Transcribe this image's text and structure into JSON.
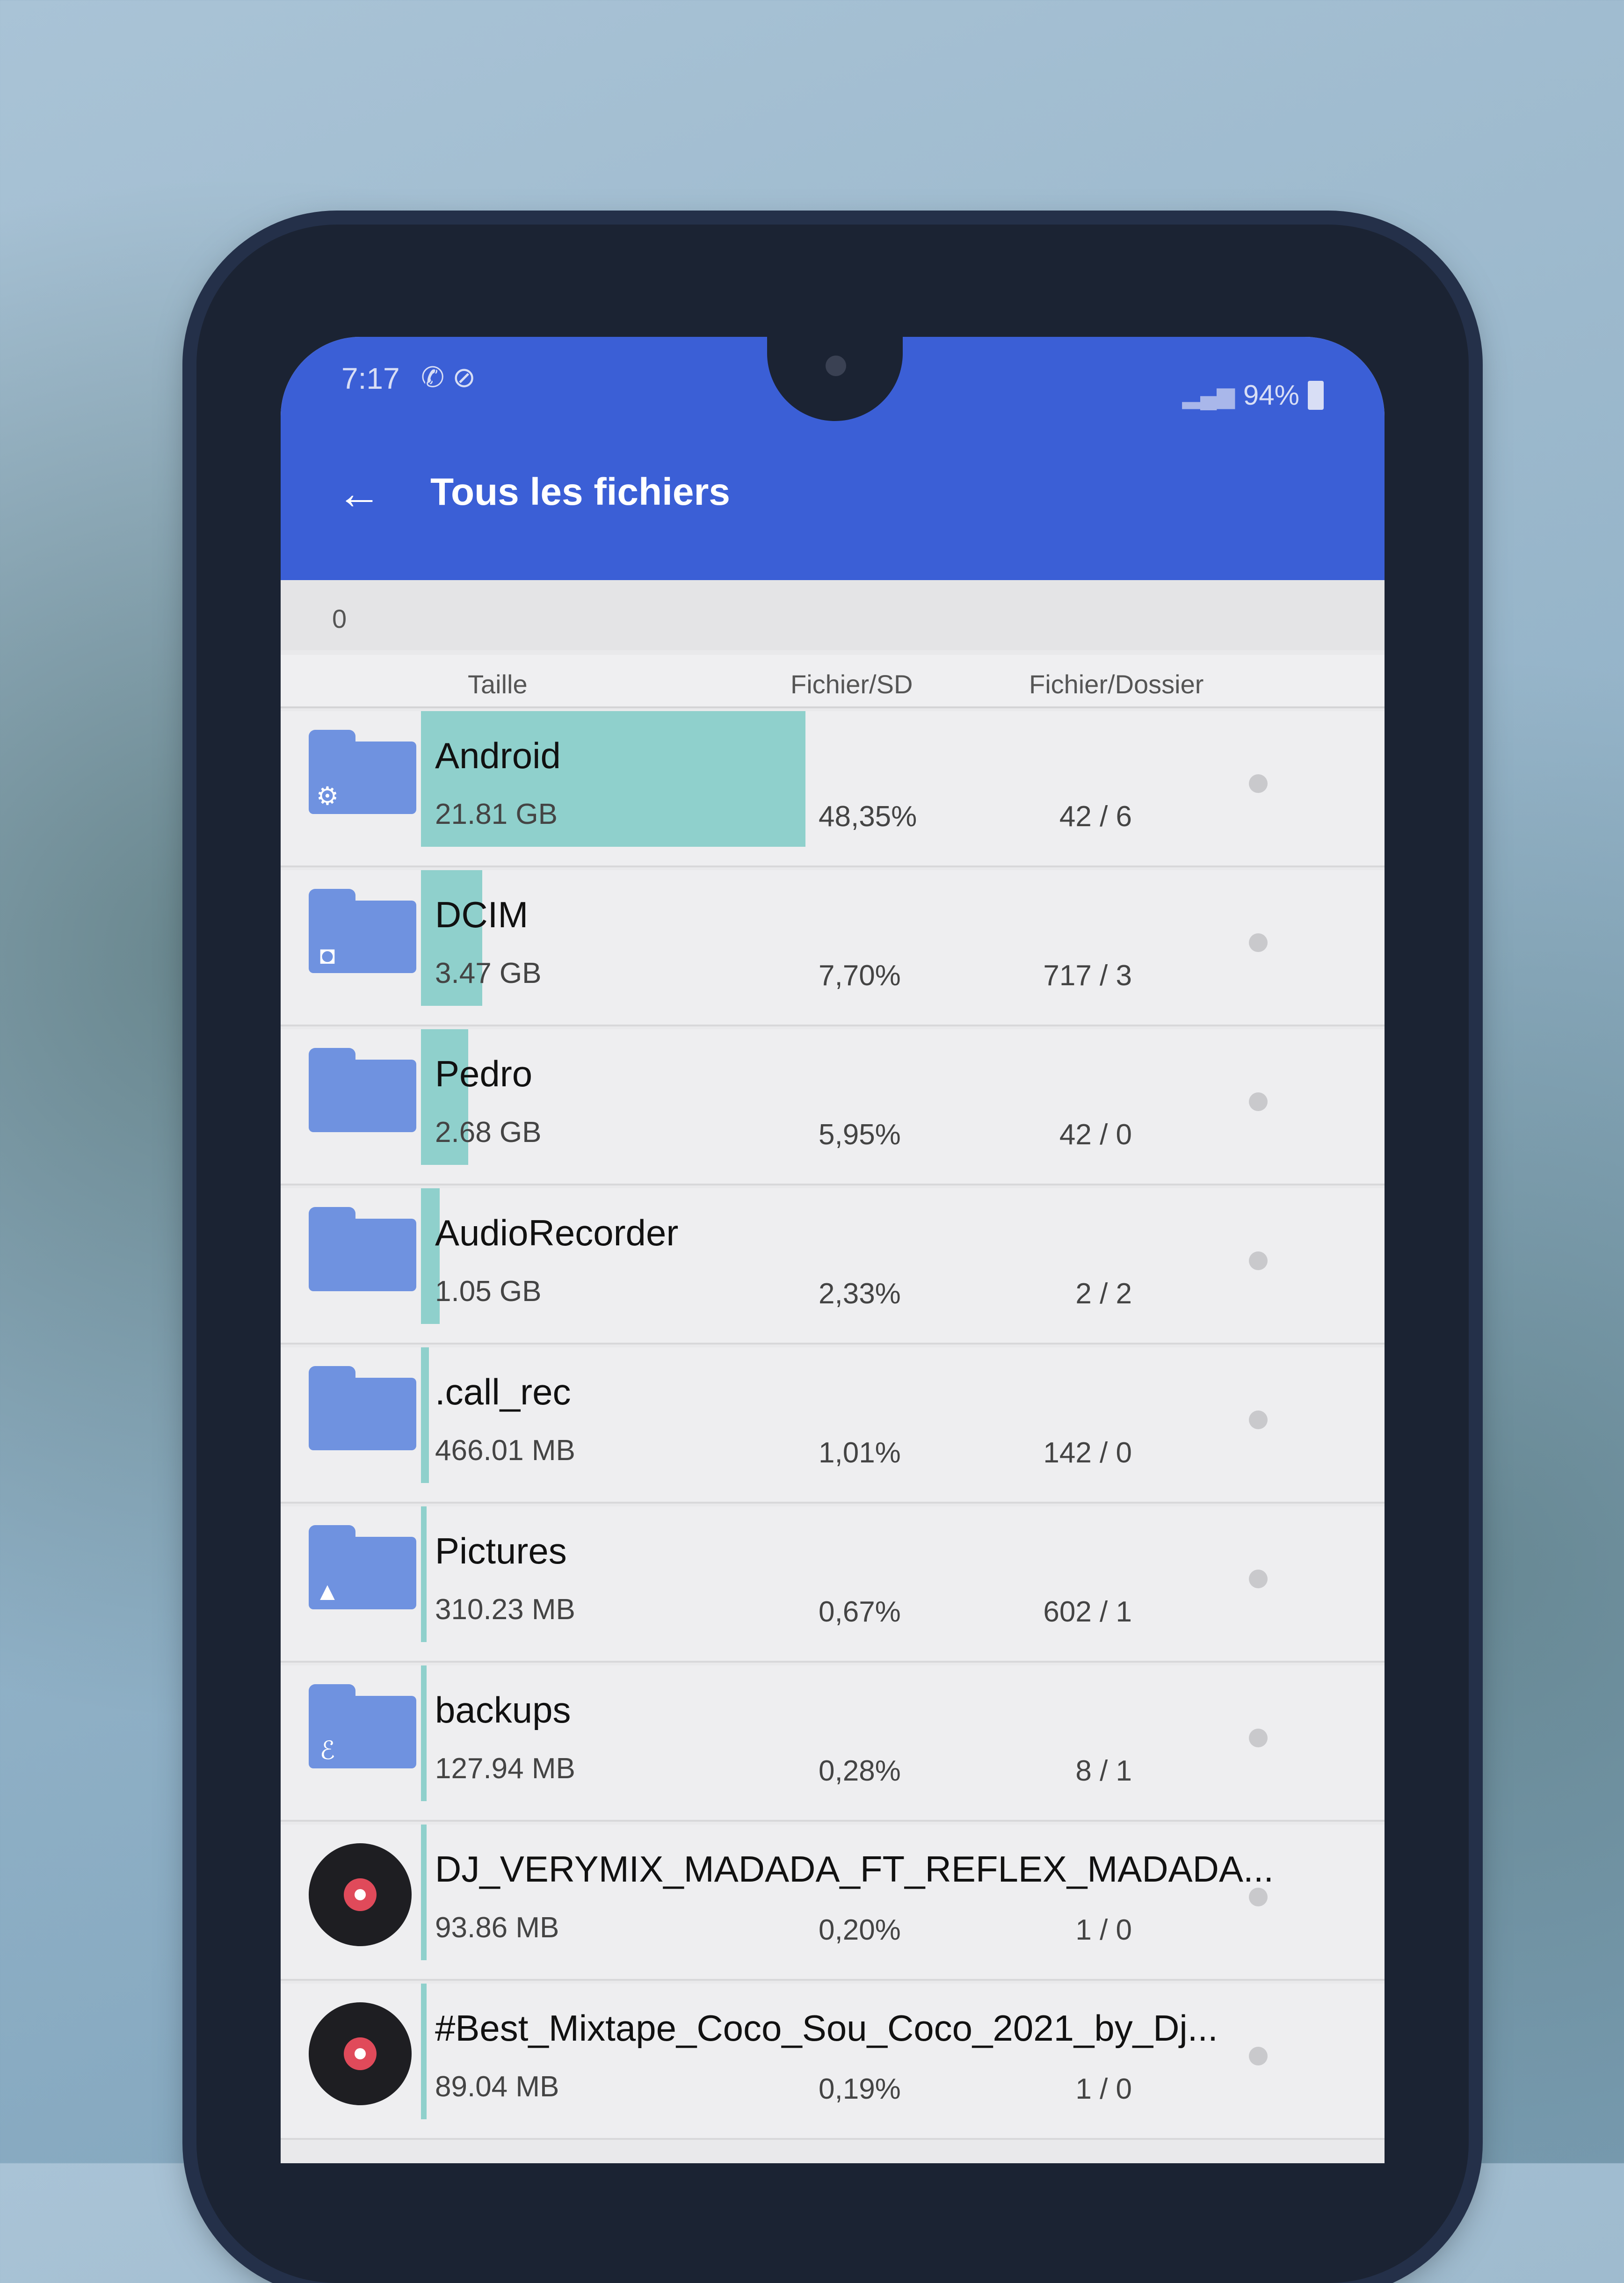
{
  "status_bar": {
    "time": "7:17",
    "battery": "94%",
    "icons": [
      "whatsapp-icon",
      "no-sim-icon",
      "signal-icon",
      "battery-icon"
    ]
  },
  "header": {
    "title": "Tous les fichiers"
  },
  "path": {
    "label": "0"
  },
  "columns": {
    "size": "Taille",
    "file_sd": "Fichier/SD",
    "file_folder": "Fichier/Dossier"
  },
  "colors": {
    "app_bar": "#3b5fd6",
    "usage_bar": "#8fd0cc",
    "folder": "#6f92e0"
  },
  "rows": [
    {
      "name": "Android",
      "size": "21.81 GB",
      "percent": "48,35%",
      "count": "42 / 6",
      "icon": "folder-settings-icon",
      "usage": 0.4835
    },
    {
      "name": "DCIM",
      "size": "3.47 GB",
      "percent": "7,70%",
      "count": "717 / 3",
      "icon": "folder-camera-icon",
      "usage": 0.077
    },
    {
      "name": "Pedro",
      "size": "2.68 GB",
      "percent": "5,95%",
      "count": "42 / 0",
      "icon": "folder-icon",
      "usage": 0.0595
    },
    {
      "name": "AudioRecorder",
      "size": "1.05 GB",
      "percent": "2,33%",
      "count": "2 / 2",
      "icon": "folder-icon",
      "usage": 0.0233
    },
    {
      "name": ".call_rec",
      "size": "466.01 MB",
      "percent": "1,01%",
      "count": "142 / 0",
      "icon": "folder-icon",
      "usage": 0.0101
    },
    {
      "name": "Pictures",
      "size": "310.23 MB",
      "percent": "0,67%",
      "count": "602 / 1",
      "icon": "folder-image-icon",
      "usage": 0.0067
    },
    {
      "name": "backups",
      "size": "127.94 MB",
      "percent": "0,28%",
      "count": "8 / 1",
      "icon": "folder-es-icon",
      "usage": 0.0028
    },
    {
      "name": "DJ_VERYMIX_MADADA_FT_REFLEX_MADADA...",
      "size": "93.86 MB",
      "percent": "0,20%",
      "count": "1 / 0",
      "icon": "music-disc-icon",
      "usage": 0.002
    },
    {
      "name": "#Best_Mixtape_Coco_Sou_Coco_2021_by_Dj...",
      "size": "89.04 MB",
      "percent": "0,19%",
      "count": "1 / 0",
      "icon": "music-disc-icon",
      "usage": 0.0019
    }
  ]
}
